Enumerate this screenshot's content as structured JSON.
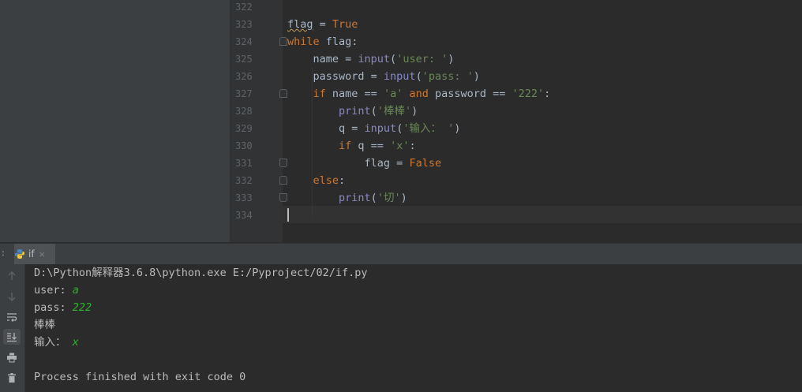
{
  "editor": {
    "lines": [
      {
        "num": "322",
        "tokens": []
      },
      {
        "num": "323",
        "tokens": [
          {
            "t": "flag",
            "c": "id squig"
          },
          {
            "t": " = ",
            "c": ""
          },
          {
            "t": "True",
            "c": "kw"
          }
        ]
      },
      {
        "num": "324",
        "tokens": [
          {
            "t": "while",
            "c": "kw"
          },
          {
            "t": " flag:",
            "c": ""
          }
        ]
      },
      {
        "num": "325",
        "tokens": [
          {
            "t": "    name = ",
            "c": ""
          },
          {
            "t": "input",
            "c": "fn"
          },
          {
            "t": "(",
            "c": ""
          },
          {
            "t": "'user: '",
            "c": "str"
          },
          {
            "t": ")",
            "c": ""
          }
        ]
      },
      {
        "num": "326",
        "tokens": [
          {
            "t": "    password = ",
            "c": ""
          },
          {
            "t": "input",
            "c": "fn"
          },
          {
            "t": "(",
            "c": ""
          },
          {
            "t": "'pass: '",
            "c": "str"
          },
          {
            "t": ")",
            "c": ""
          }
        ]
      },
      {
        "num": "327",
        "tokens": [
          {
            "t": "    ",
            "c": ""
          },
          {
            "t": "if",
            "c": "kw"
          },
          {
            "t": " name == ",
            "c": ""
          },
          {
            "t": "'a'",
            "c": "str"
          },
          {
            "t": " ",
            "c": ""
          },
          {
            "t": "and",
            "c": "kw"
          },
          {
            "t": " password == ",
            "c": ""
          },
          {
            "t": "'222'",
            "c": "str"
          },
          {
            "t": ":",
            "c": ""
          }
        ]
      },
      {
        "num": "328",
        "tokens": [
          {
            "t": "        ",
            "c": ""
          },
          {
            "t": "print",
            "c": "fn"
          },
          {
            "t": "(",
            "c": ""
          },
          {
            "t": "'棒棒'",
            "c": "str"
          },
          {
            "t": ")",
            "c": ""
          }
        ]
      },
      {
        "num": "329",
        "tokens": [
          {
            "t": "        q = ",
            "c": ""
          },
          {
            "t": "input",
            "c": "fn"
          },
          {
            "t": "(",
            "c": ""
          },
          {
            "t": "'输入： '",
            "c": "str"
          },
          {
            "t": ")",
            "c": ""
          }
        ]
      },
      {
        "num": "330",
        "tokens": [
          {
            "t": "        ",
            "c": ""
          },
          {
            "t": "if",
            "c": "kw"
          },
          {
            "t": " q == ",
            "c": ""
          },
          {
            "t": "'x'",
            "c": "str"
          },
          {
            "t": ":",
            "c": ""
          }
        ]
      },
      {
        "num": "331",
        "tokens": [
          {
            "t": "            flag = ",
            "c": ""
          },
          {
            "t": "False",
            "c": "kw"
          }
        ]
      },
      {
        "num": "332",
        "tokens": [
          {
            "t": "    ",
            "c": ""
          },
          {
            "t": "else",
            "c": "kw"
          },
          {
            "t": ":",
            "c": ""
          }
        ]
      },
      {
        "num": "333",
        "tokens": [
          {
            "t": "        ",
            "c": ""
          },
          {
            "t": "print",
            "c": "fn"
          },
          {
            "t": "(",
            "c": ""
          },
          {
            "t": "'切'",
            "c": "str"
          },
          {
            "t": ")",
            "c": ""
          }
        ]
      },
      {
        "num": "334",
        "tokens": []
      }
    ]
  },
  "run_panel": {
    "prefix": ":",
    "tab_label": "if",
    "tab_close": "×",
    "toolbar_icons": [
      "arrow-up-icon",
      "arrow-down-icon",
      "soft-wrap-icon",
      "scroll-to-end-icon",
      "print-icon",
      "trash-icon"
    ],
    "console": [
      {
        "segments": [
          {
            "t": "D:\\Python解释器3.6.8\\python.exe E:/Pyproject/02/if.py",
            "c": ""
          }
        ]
      },
      {
        "segments": [
          {
            "t": "user: ",
            "c": ""
          },
          {
            "t": "a",
            "c": "user-in"
          }
        ]
      },
      {
        "segments": [
          {
            "t": "pass: ",
            "c": ""
          },
          {
            "t": "222",
            "c": "user-in"
          }
        ]
      },
      {
        "segments": [
          {
            "t": "棒棒",
            "c": ""
          }
        ]
      },
      {
        "segments": [
          {
            "t": "输入： ",
            "c": ""
          },
          {
            "t": "x",
            "c": "user-in"
          }
        ]
      },
      {
        "segments": []
      },
      {
        "segments": [
          {
            "t": "Process finished with exit code 0",
            "c": ""
          }
        ]
      }
    ]
  },
  "colors": {
    "keyword": "#cc7832",
    "string": "#6a8759",
    "builtin": "#8888c6",
    "user_input": "#2eb02e",
    "text": "#a9b7c6"
  }
}
